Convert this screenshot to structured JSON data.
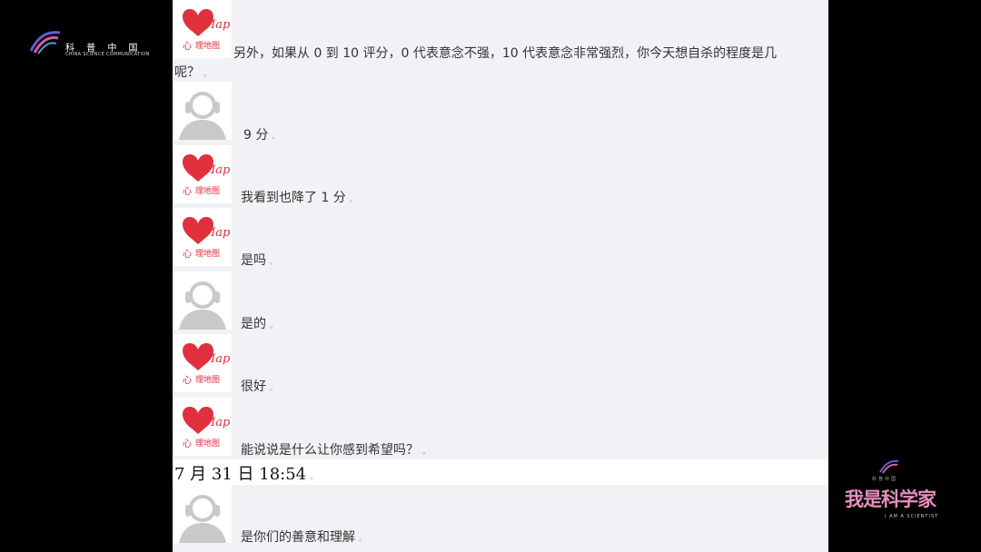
{
  "branding": {
    "left_logo_cn": "科 普 中 国",
    "left_logo_en": "CHINA SCIENCE COMMUNICATION",
    "right_logo_tiny": "科普中国",
    "right_logo_title": "我是科学家",
    "right_logo_sub": "I AM A SCIENTIST"
  },
  "avatars": {
    "counselor_text_top": "Map",
    "counselor_text_bottom": "理地图"
  },
  "messages": [
    {
      "sender": "counselor",
      "line1": "另外，如果从 0 到 10 评分，0 代表意念不强，10 代表意念非常强烈，你今天想自杀的程度是几",
      "line2": "呢？"
    },
    {
      "sender": "user",
      "line1": "9 分"
    },
    {
      "sender": "counselor",
      "line1": "我看到也降了 1 分"
    },
    {
      "sender": "counselor",
      "line1": "是吗"
    },
    {
      "sender": "user",
      "line1": "是的"
    },
    {
      "sender": "counselor",
      "line1": "很好"
    },
    {
      "sender": "counselor",
      "line1": "能说说是什么让你感到希望吗？"
    },
    {
      "sender": "user",
      "line1": "是你们的善意和理解"
    }
  ],
  "timestamp": "7 月 31 日  18:54",
  "colors": {
    "chat_bg": "#f2f2f6",
    "counselor_heart": "#e0303d",
    "user_avatar": "#c9c9c9",
    "right_logo_pink": "#e78fbf"
  }
}
